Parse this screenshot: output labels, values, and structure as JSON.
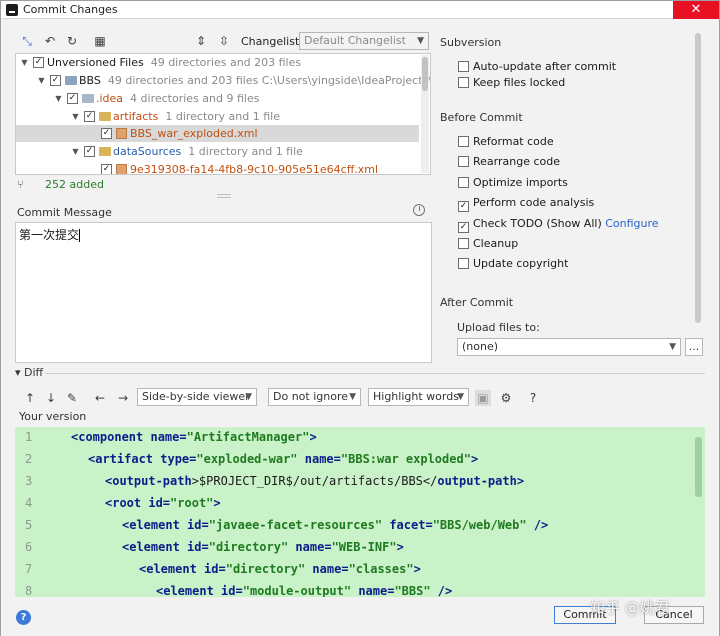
{
  "window": {
    "title": "Commit Changes",
    "close_glyph": "✕"
  },
  "toolbar": {
    "changelist_label": "Changelist:",
    "changelist_value": "Default Changelist",
    "icons": [
      "move-icon",
      "undo-icon",
      "refresh-icon",
      "group-icon",
      "expand-all-icon",
      "collapse-all-icon"
    ]
  },
  "tree": {
    "rows": [
      {
        "name": "Unversioned Files",
        "meta": "49 directories and 203 files"
      },
      {
        "name": "BBS",
        "meta": "49 directories and 203 files  C:\\Users\\yingside\\IdeaProjects\\BBS"
      },
      {
        "name": ".idea",
        "meta": "4 directories and 9 files"
      },
      {
        "name": "artifacts",
        "meta": "1 directory and 1 file"
      },
      {
        "name": "BBS_war_exploded.xml",
        "meta": ""
      },
      {
        "name": "dataSources",
        "meta": "1 directory and 1 file"
      },
      {
        "name": "9e319308-fa14-4fb8-9c10-905e51e64cff.xml",
        "meta": ""
      }
    ],
    "added": "252 added"
  },
  "commit_message": {
    "label": "Commit Message",
    "value": "第一次提交"
  },
  "subversion": {
    "title": "Subversion",
    "options": [
      {
        "label": "Auto-update after commit",
        "checked": false
      },
      {
        "label": "Keep files locked",
        "checked": false
      }
    ]
  },
  "before_commit": {
    "title": "Before Commit",
    "options": [
      {
        "label": "Reformat code",
        "checked": false
      },
      {
        "label": "Rearrange code",
        "checked": false
      },
      {
        "label": "Optimize imports",
        "checked": false
      },
      {
        "label": "Perform code analysis",
        "checked": true
      },
      {
        "label": "Check TODO (Show All)",
        "checked": true,
        "link": "Configure"
      },
      {
        "label": "Cleanup",
        "checked": false
      },
      {
        "label": "Update copyright",
        "checked": false
      }
    ]
  },
  "after_commit": {
    "title": "After Commit",
    "upload_label": "Upload files to:",
    "upload_value": "(none)",
    "browse_label": "..."
  },
  "diff": {
    "title": "Diff",
    "viewer": "Side-by-side viewer",
    "ignore": "Do not ignore",
    "highlight": "Highlight words",
    "help_glyph": "?",
    "your_version": "Your version",
    "lines": [
      {
        "n": "1"
      },
      {
        "n": "2"
      },
      {
        "n": "3"
      },
      {
        "n": "4"
      },
      {
        "n": "5"
      },
      {
        "n": "6"
      },
      {
        "n": "7"
      },
      {
        "n": "8"
      }
    ],
    "code": {
      "l1": {
        "t1": "<component ",
        "a1": "name=",
        "v1": "\"ArtifactManager\"",
        "t2": ">"
      },
      "l2": {
        "t1": "<artifact ",
        "a1": "type=",
        "v1": "\"exploded-war\"",
        "a2": " name=",
        "v2": "\"BBS:war exploded\"",
        "t2": ">"
      },
      "l3": {
        "t1": "<output-path",
        "tx": ">$PROJECT_DIR$/out/artifacts/BBS</",
        "t2": "output-path",
        "t3": ">"
      },
      "l4": {
        "t1": "<root ",
        "a1": "id=",
        "v1": "\"root\"",
        "t2": ">"
      },
      "l5": {
        "t1": "<element ",
        "a1": "id=",
        "v1": "\"javaee-facet-resources\"",
        "a2": " facet=",
        "v2": "\"BBS/web/Web\"",
        "t2": " />"
      },
      "l6": {
        "t1": "<element ",
        "a1": "id=",
        "v1": "\"directory\"",
        "a2": " name=",
        "v2": "\"WEB-INF\"",
        "t2": ">"
      },
      "l7": {
        "t1": "<element ",
        "a1": "id=",
        "v1": "\"directory\"",
        "a2": " name=",
        "v2": "\"classes\"",
        "t2": ">"
      },
      "l8": {
        "t1": "<element ",
        "a1": "id=",
        "v1": "\"module-output\"",
        "a2": " name=",
        "v2": "\"BBS\"",
        "t2": " />"
      }
    }
  },
  "buttons": {
    "commit": "Commit",
    "cancel": "Cancel",
    "help": "?"
  },
  "watermark": "知乎 @姚君"
}
